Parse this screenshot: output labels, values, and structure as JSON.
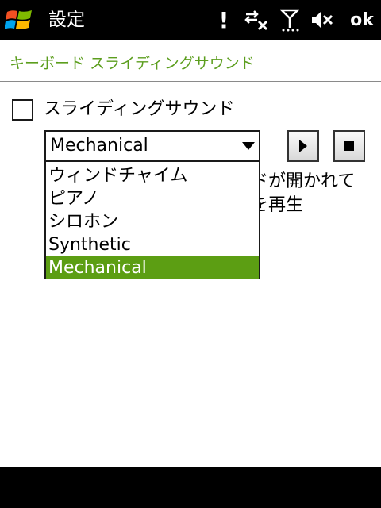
{
  "titlebar": {
    "title": "設定",
    "alert_glyph": "!",
    "ok_label": "ok",
    "icons": [
      "windows-start-icon",
      "alert-icon",
      "data-disconnected-icon",
      "signal-off-icon",
      "volume-muted-icon"
    ]
  },
  "header": {
    "title": "キーボード スライディングサウンド"
  },
  "option": {
    "label": "スライディングサウンド",
    "checked": false
  },
  "dropdown": {
    "selected": "Mechanical",
    "options": [
      "ウィンドチャイム",
      "ピアノ",
      "シロホン",
      "Synthetic",
      "Mechanical"
    ],
    "highlighted_index": 4
  },
  "buttons": {
    "play_icon": "play-icon",
    "stop_icon": "stop-icon"
  },
  "description": {
    "line1_visible": "ドが開かれて",
    "line2_visible": "を再生"
  },
  "colors": {
    "accent": "#5c9e13",
    "header_text": "#5c9e1e",
    "bar": "#000000"
  }
}
